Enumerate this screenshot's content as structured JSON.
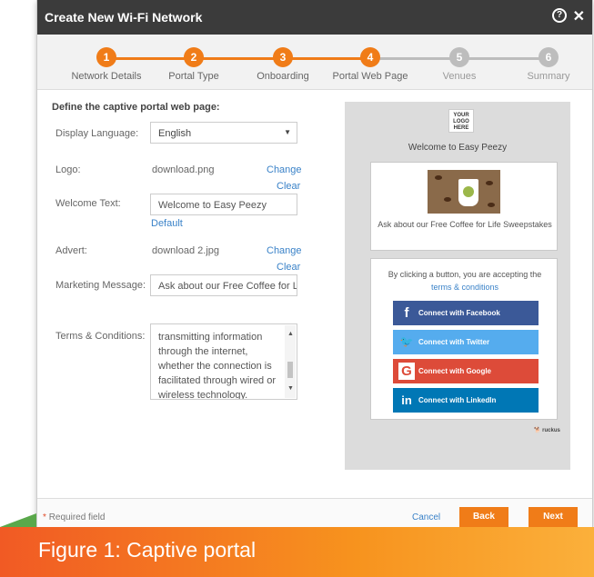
{
  "window": {
    "title": "Create New Wi-Fi Network",
    "help_icon": "?",
    "close_icon": "✕"
  },
  "steps": [
    {
      "num": "1",
      "label": "Network Details",
      "state": "done"
    },
    {
      "num": "2",
      "label": "Portal Type",
      "state": "done"
    },
    {
      "num": "3",
      "label": "Onboarding",
      "state": "done"
    },
    {
      "num": "4",
      "label": "Portal Web Page",
      "state": "current"
    },
    {
      "num": "5",
      "label": "Venues",
      "state": "todo"
    },
    {
      "num": "6",
      "label": "Summary",
      "state": "todo"
    }
  ],
  "form": {
    "heading": "Define the captive portal web page:",
    "display_language": {
      "label": "Display Language:",
      "value": "English"
    },
    "logo": {
      "label": "Logo:",
      "value": "download.png",
      "change": "Change",
      "clear": "Clear"
    },
    "welcome": {
      "label": "Welcome Text:",
      "value": "Welcome to Easy Peezy",
      "default": "Default"
    },
    "advert": {
      "label": "Advert:",
      "value": "download 2.jpg",
      "change": "Change",
      "clear": "Clear"
    },
    "marketing": {
      "label": "Marketing Message:",
      "value": "Ask about our Free Coffee for Life"
    },
    "terms": {
      "label": "Terms & Conditions:",
      "value": "transmitting information through the internet, whether the connection is facilitated through wired or wireless technology."
    }
  },
  "preview": {
    "logo_text": "YOUR LOGO HERE",
    "welcome": "Welcome to Easy Peezy",
    "advert_text": "Ask about our Free Coffee for Life Sweepstakes",
    "accept_text": "By clicking a button, you are accepting the",
    "terms_link": "terms & conditions",
    "social": [
      {
        "icon": "f",
        "label": "Connect with Facebook",
        "color": "#3b5998"
      },
      {
        "icon": "🐦",
        "label": "Connect with Twitter",
        "color": "#55acee"
      },
      {
        "icon": "G",
        "label": "Connect with Google",
        "color": "#dd4b39"
      },
      {
        "icon": "in",
        "label": "Connect with LinkedIn",
        "color": "#0077b5"
      }
    ],
    "brand": "ruckus"
  },
  "footer": {
    "required_star": "*",
    "required": "Required field",
    "cancel": "Cancel",
    "back": "Back",
    "next": "Next"
  },
  "caption": "Figure 1: Captive portal",
  "colors": {
    "accent": "#f07c18",
    "inactive": "#bdbdbd",
    "titlebar": "#3b3b3b",
    "link": "#3a82c8"
  }
}
